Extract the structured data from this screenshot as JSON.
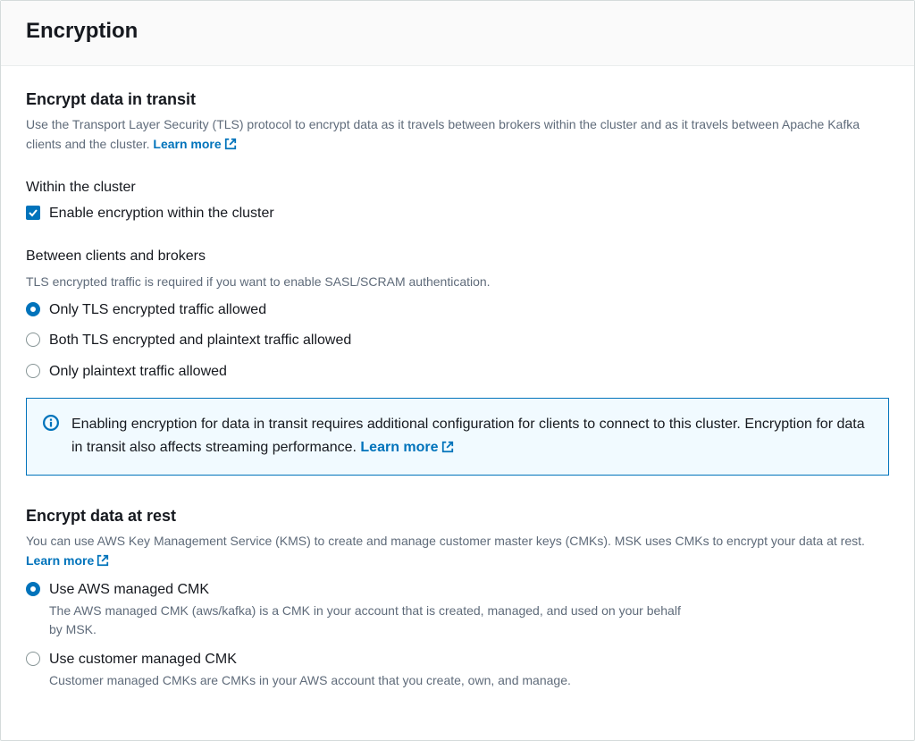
{
  "header": {
    "title": "Encryption"
  },
  "transit": {
    "title": "Encrypt data in transit",
    "desc": "Use the Transport Layer Security (TLS) protocol to encrypt data as it travels between brokers within the cluster and as it travels between Apache Kafka clients and the cluster. ",
    "learn_more": "Learn more",
    "within_label": "Within the cluster",
    "within_option": "Enable encryption within the cluster",
    "between_label": "Between clients and brokers",
    "between_helper": "TLS encrypted traffic is required if you want to enable SASL/SCRAM authentication.",
    "options": [
      "Only TLS encrypted traffic allowed",
      "Both TLS encrypted and plaintext traffic allowed",
      "Only plaintext traffic allowed"
    ],
    "info_text": "Enabling encryption for data in transit requires additional configuration for clients to connect to this cluster. Encryption for data in transit also affects streaming performance. ",
    "info_learn_more": "Learn more"
  },
  "rest": {
    "title": "Encrypt data at rest",
    "desc": "You can use AWS Key Management Service (KMS) to create and manage customer master keys (CMKs). MSK uses CMKs to encrypt your data at rest. ",
    "learn_more": "Learn more",
    "options": [
      {
        "label": "Use AWS managed CMK",
        "desc": "The AWS managed CMK (aws/kafka) is a CMK in your account that is created, managed, and used on your behalf by MSK."
      },
      {
        "label": "Use customer managed CMK",
        "desc": "Customer managed CMKs are CMKs in your AWS account that you create, own, and manage."
      }
    ]
  }
}
